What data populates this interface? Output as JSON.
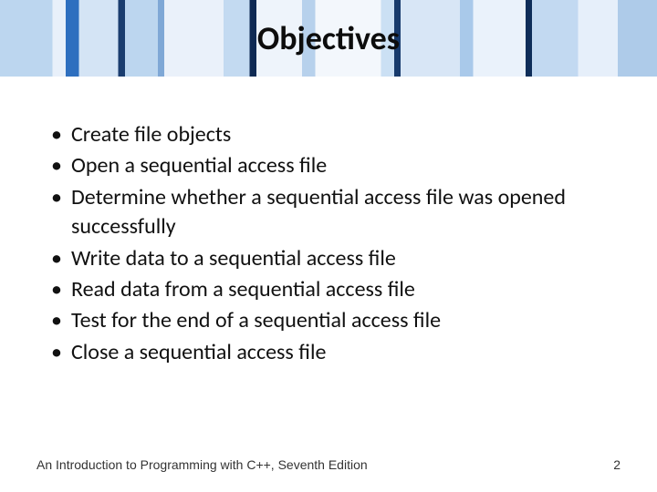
{
  "header": {
    "title": "Objectives"
  },
  "bullets": [
    "Create file objects",
    "Open a sequential access file",
    "Determine whether a sequential access file was opened successfully",
    "Write data to a sequential access file",
    "Read data from a sequential access file",
    "Test for the end of a sequential access file",
    "Close a sequential access file"
  ],
  "footer": {
    "text": "An Introduction to Programming with C++, Seventh Edition",
    "page": "2"
  }
}
